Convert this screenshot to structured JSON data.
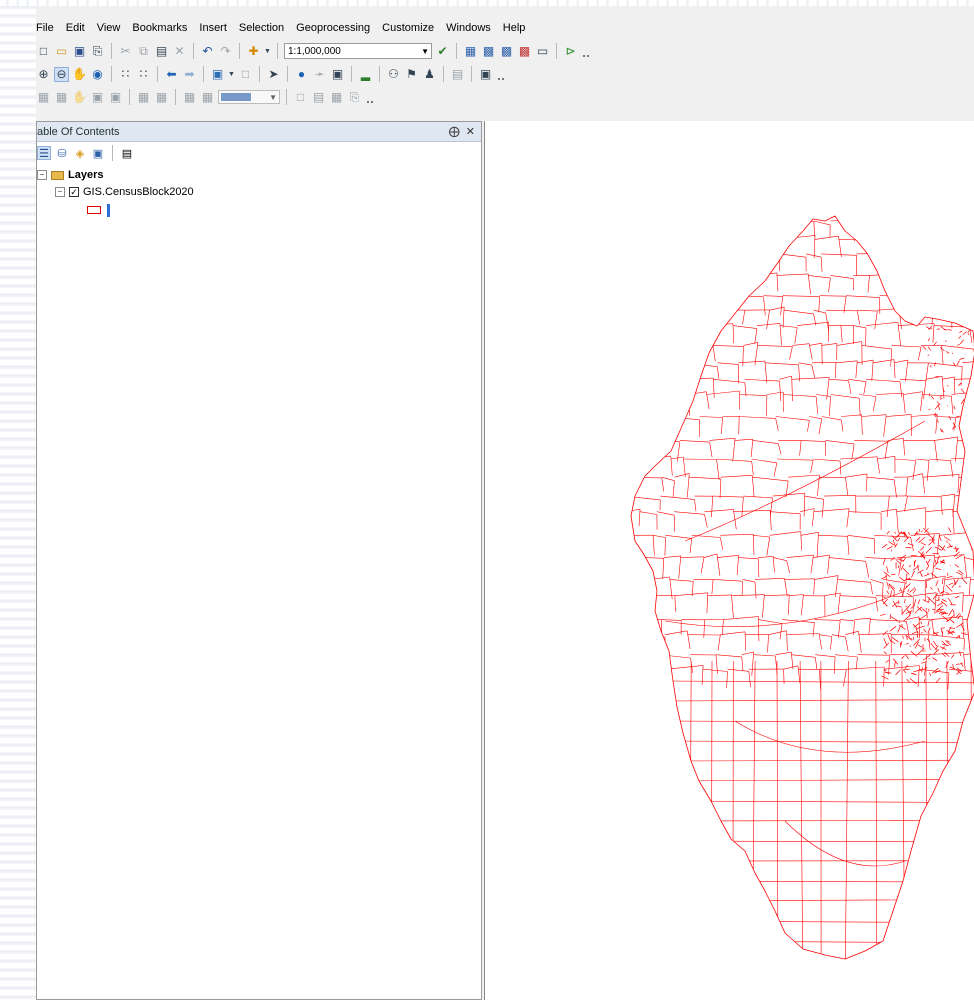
{
  "menu": [
    "File",
    "Edit",
    "View",
    "Bookmarks",
    "Insert",
    "Selection",
    "Geoprocessing",
    "Customize",
    "Windows",
    "Help"
  ],
  "toolbar": {
    "scale_value": "1:1,000,000",
    "standard_icons": [
      "new-icon",
      "open-icon",
      "save-icon",
      "print-icon",
      "cut-icon",
      "copy-icon",
      "paste-icon",
      "delete-icon",
      "undo-icon",
      "redo-icon",
      "add-data-icon"
    ],
    "standard_icons_after": [
      "editor-icon",
      "table-window-icon",
      "catalog-icon",
      "search-window-icon",
      "arctoolbox-icon",
      "python-window-icon",
      "model-builder-icon"
    ],
    "tools_icons": [
      "zoom-in-icon",
      "zoom-out-icon",
      "pan-icon",
      "full-extent-icon",
      "fixed-zoom-in-icon",
      "fixed-zoom-out-icon",
      "back-extent-icon",
      "forward-extent-icon",
      "select-features-icon",
      "clear-selection-icon",
      "select-elements-icon",
      "identify-icon",
      "hyperlink-icon",
      "html-popup-icon",
      "measure-icon",
      "find-icon",
      "find-route-icon",
      "xy-icon",
      "time-slider-icon",
      "viewer-window-icon"
    ],
    "layout_icons": [
      "layout-zoom-in-icon",
      "layout-zoom-out-icon",
      "layout-pan-icon",
      "layout-full-icon",
      "layout-100-icon",
      "layout-fixed-in-icon",
      "layout-fixed-out-icon",
      "layout-back-icon",
      "layout-forward-icon",
      "focus-data-frame-icon",
      "change-layout-icon",
      "data-driven-pages-icon"
    ]
  },
  "toc": {
    "title": "able Of Contents",
    "pin_glyph": "⨁",
    "close_glyph": "✕",
    "toolbar_icons": [
      "list-by-drawing-order-icon",
      "list-by-source-icon",
      "list-by-visibility-icon",
      "list-by-selection-icon",
      "options-icon"
    ],
    "tree": {
      "data_frame": "Layers",
      "layer": "GIS.CensusBlock2020",
      "layer_checked": true
    }
  },
  "map": {
    "stroke_color": "#ff0000",
    "background": "#ffffff",
    "layer_name": "GIS.CensusBlock2020"
  }
}
